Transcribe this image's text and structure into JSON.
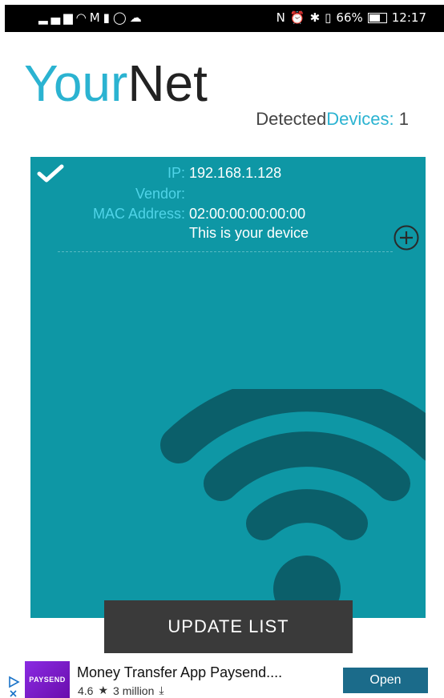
{
  "status_bar": {
    "left_icons": [
      "signal-icon",
      "wifi-icon",
      "gmail-icon",
      "battery-saver-icon",
      "whatsapp-icon",
      "cloud-icon"
    ],
    "right_icons": [
      "nfc-icon",
      "alarm-icon",
      "bluetooth-icon",
      "vibrate-icon"
    ],
    "battery_percent": "66%",
    "time": "12:17"
  },
  "header": {
    "logo_part1": "Your",
    "logo_part2": "Net",
    "detected_prefix": "Detected",
    "detected_word": "Devices:",
    "detected_count": "1"
  },
  "device": {
    "ip_label": "IP:",
    "ip_value": "192.168.1.128",
    "vendor_label": "Vendor:",
    "vendor_value": "",
    "mac_label": "MAC Address:",
    "mac_value": "02:00:00:00:00:00",
    "note": "This is your device"
  },
  "update_button": "UPDATE LIST",
  "ad": {
    "logo_text": "PAYSEND",
    "title": "Money Transfer App Paysend....",
    "rating": "4.6",
    "installs": "3 million",
    "open_label": "Open"
  },
  "colors": {
    "accent": "#2bb3d1",
    "panel": "#0e97a5",
    "wifi": "#0b5f6a",
    "button": "#3a3a3a"
  }
}
